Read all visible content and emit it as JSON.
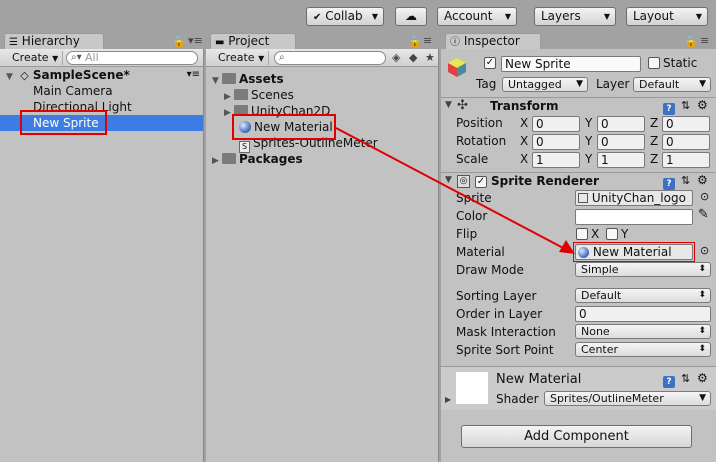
{
  "toolbar": {
    "collab": "Collab",
    "cloud_icon": "cloud-icon",
    "account": "Account",
    "layers": "Layers",
    "layout": "Layout"
  },
  "hierarchy": {
    "tab": "Hierarchy",
    "create": "Create",
    "search_placeholder": "All",
    "scene": "SampleScene*",
    "items": [
      "Main Camera",
      "Directional Light",
      "New Sprite"
    ]
  },
  "project": {
    "tab": "Project",
    "create": "Create",
    "assets": "Assets",
    "items": [
      "Scenes",
      "UnityChan2D",
      "New Material",
      "Sprites-OutlineMeter"
    ],
    "packages": "Packages"
  },
  "inspector": {
    "tab": "Inspector",
    "name": "New Sprite",
    "static": "Static",
    "tag_label": "Tag",
    "tag_value": "Untagged",
    "layer_label": "Layer",
    "layer_value": "Default",
    "transform": {
      "title": "Transform",
      "position_label": "Position",
      "rotation_label": "Rotation",
      "scale_label": "Scale",
      "x": "X",
      "y": "Y",
      "z": "Z",
      "position": [
        "0",
        "0",
        "0"
      ],
      "rotation": [
        "0",
        "0",
        "0"
      ],
      "scale": [
        "1",
        "1",
        "1"
      ]
    },
    "sprite_renderer": {
      "title": "Sprite Renderer",
      "sprite_label": "Sprite",
      "sprite_value": "UnityChan_logo",
      "color_label": "Color",
      "flip_label": "Flip",
      "flip_x": "X",
      "flip_y": "Y",
      "material_label": "Material",
      "material_value": "New Material",
      "draw_mode_label": "Draw Mode",
      "draw_mode_value": "Simple",
      "sorting_layer_label": "Sorting Layer",
      "sorting_layer_value": "Default",
      "order_label": "Order in Layer",
      "order_value": "0",
      "mask_label": "Mask Interaction",
      "mask_value": "None",
      "sort_point_label": "Sprite Sort Point",
      "sort_point_value": "Center"
    },
    "material": {
      "name": "New Material",
      "shader_label": "Shader",
      "shader_value": "Sprites/OutlineMeter"
    },
    "add_component": "Add Component"
  },
  "colors": {
    "selection": "#3e7ce4",
    "annotation_red": "#e00000"
  }
}
